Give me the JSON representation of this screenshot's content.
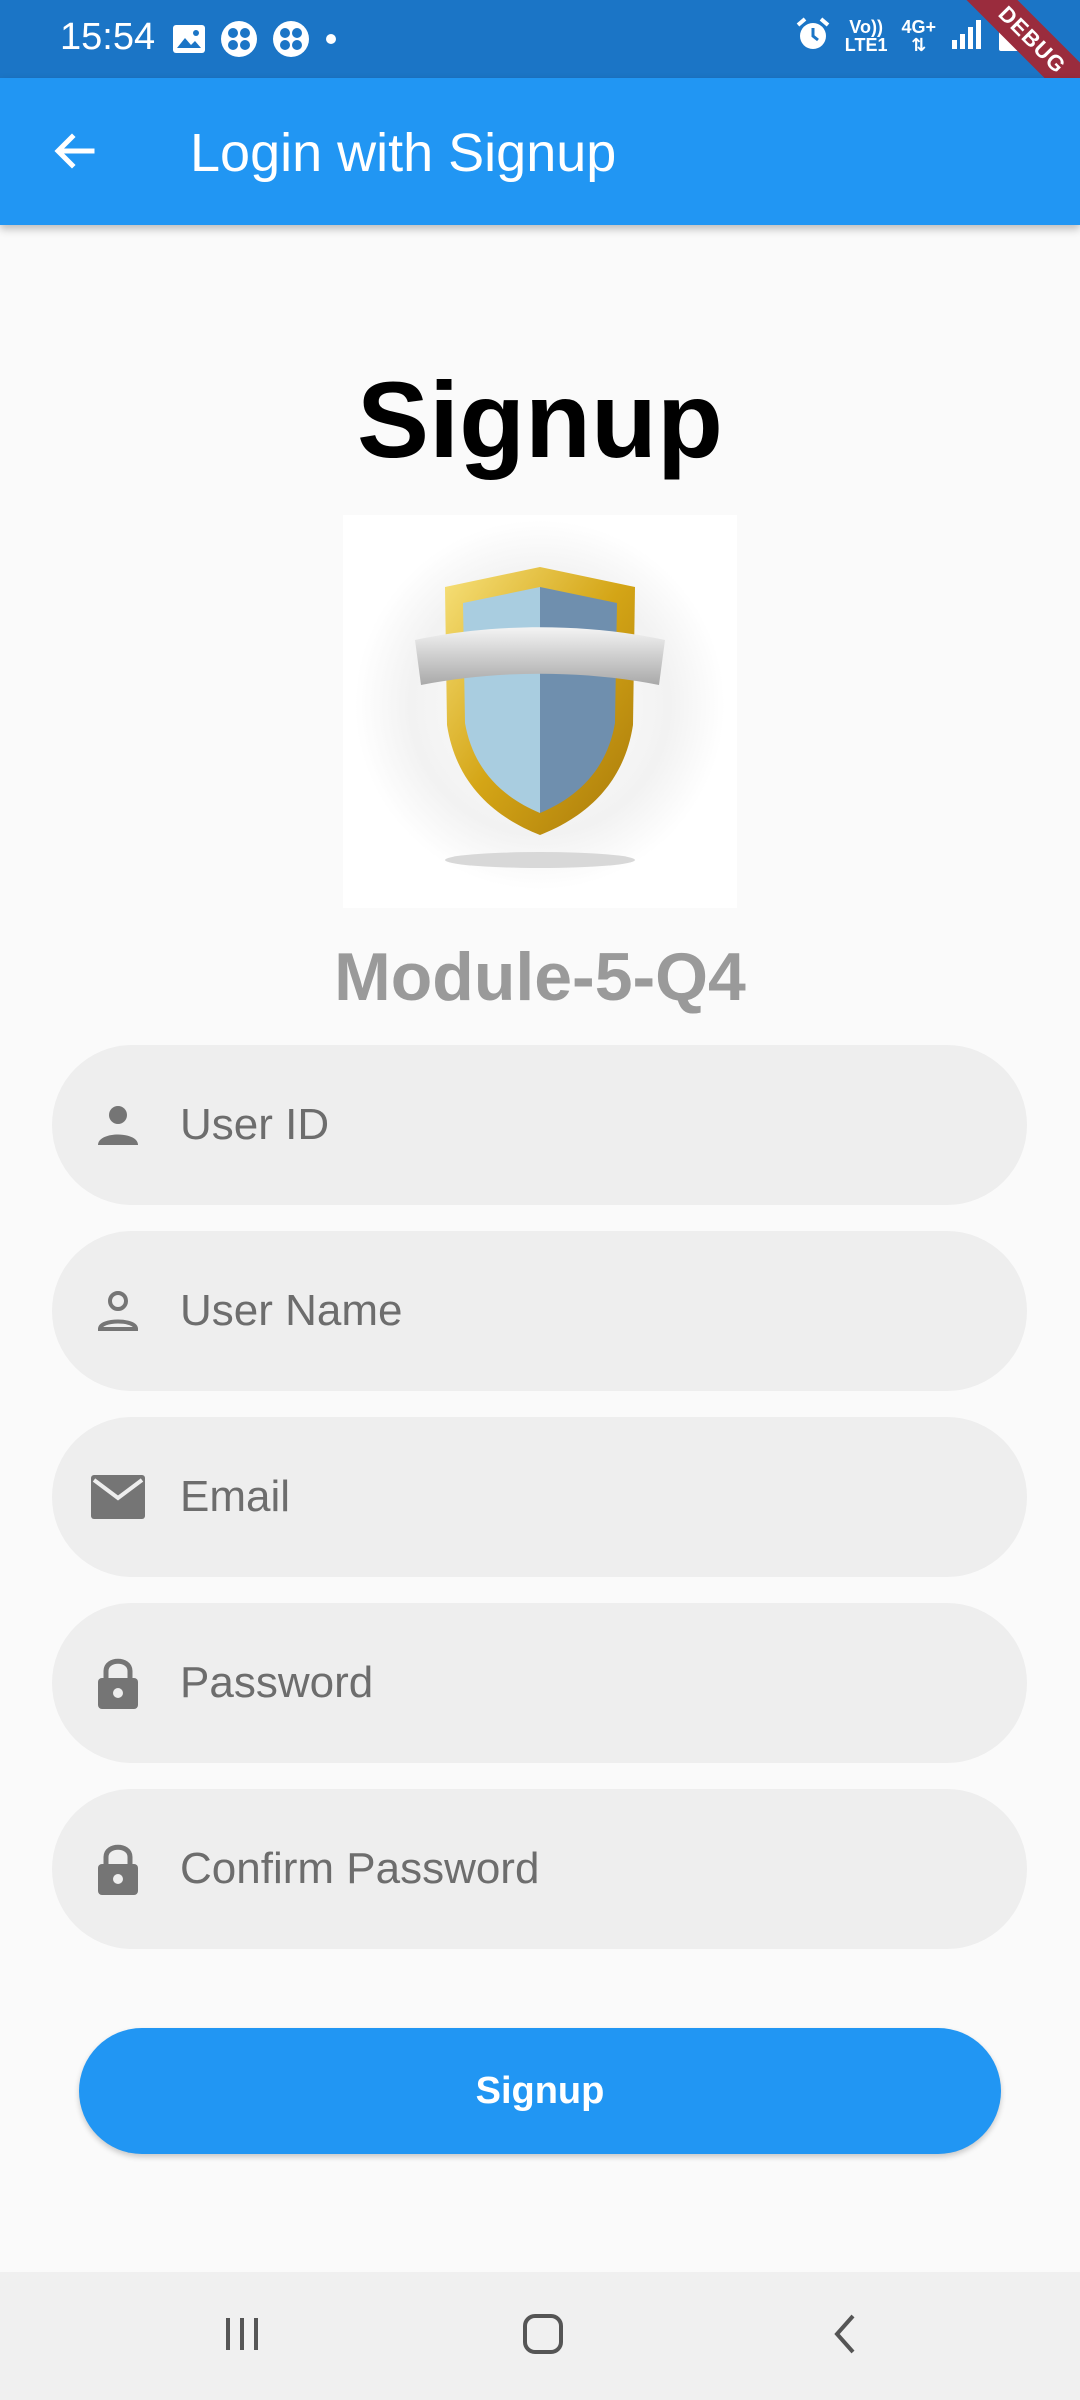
{
  "status_bar": {
    "time": "15:54",
    "left_icons": [
      "image-icon",
      "fan-icon",
      "fan-icon",
      "dot-icon"
    ],
    "network_top": "Vo))",
    "network_bottom": "LTE1",
    "data_type": "4G+",
    "debug_label": "DEBUG"
  },
  "app_bar": {
    "title": "Login with Signup",
    "back_icon": "arrow-back-icon",
    "color": "#2196f3"
  },
  "page": {
    "title": "Signup",
    "logo_icon": "shield-icon",
    "module_label": "Module-5-Q4"
  },
  "form": {
    "user_id": {
      "placeholder": "User ID",
      "icon": "person-icon",
      "value": ""
    },
    "user_name": {
      "placeholder": "User Name",
      "icon": "person-outline-icon",
      "value": ""
    },
    "email": {
      "placeholder": "Email",
      "icon": "email-icon",
      "value": ""
    },
    "password": {
      "placeholder": "Password",
      "icon": "lock-icon",
      "value": ""
    },
    "confirm_password": {
      "placeholder": "Confirm Password",
      "icon": "lock-icon",
      "value": ""
    },
    "submit_label": "Signup"
  },
  "nav_bar": {
    "items": [
      "recent-apps-icon",
      "home-icon",
      "back-icon"
    ]
  }
}
